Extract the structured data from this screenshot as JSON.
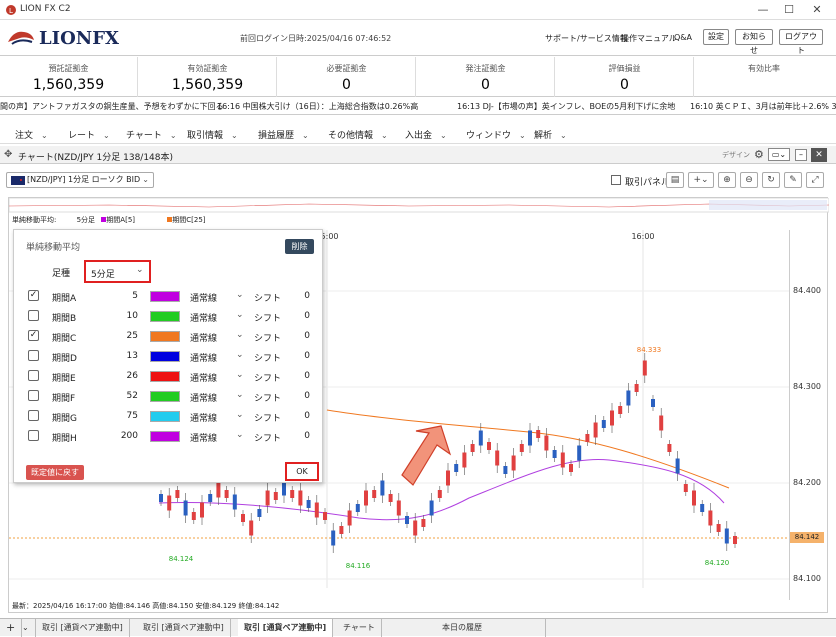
{
  "window": {
    "title": "LION FX C2",
    "minimize": "—",
    "maximize": "☐",
    "close": "✕"
  },
  "header": {
    "brand": "LIONFX",
    "last_login": "前回ログイン日時:2025/04/16 07:46:52",
    "links": [
      "サポート/サービス情報",
      "操作マニュアル",
      "Q&A"
    ],
    "buttons": [
      "設定",
      "お知らせ",
      "ログアウト"
    ]
  },
  "stats": [
    {
      "label": "預託証拠金",
      "value": "1,560,359"
    },
    {
      "label": "有効証拠金",
      "value": "1,560,359"
    },
    {
      "label": "必要証拠金",
      "value": "0"
    },
    {
      "label": "発注証拠金",
      "value": "0"
    },
    {
      "label": "評価損益",
      "value": "0"
    },
    {
      "label": "有効比率",
      "value": ""
    }
  ],
  "ticker": [
    "間の声】アントファガスタの銅生産量、予想をわずかに下回る",
    "16:16 中国株大引け（16日）：上海総合指数は0.26%高",
    "16:13 DJ-【市場の声】英インフレ、BOEの5月利下げに余地",
    "16:10 英ＣＰＩ、3月は前年比＋2.6%  3カ"
  ],
  "menu": [
    "注文",
    "レート",
    "チャート",
    "取引情報",
    "損益履歴",
    "その他情報",
    "入出金",
    "ウィンドウ",
    "解析"
  ],
  "panel": {
    "title": "チャート(NZD/JPY 1分足 138/148本)",
    "design": "デザイン"
  },
  "chart_toolbar": {
    "symbol": "[NZD/JPY] 1分足 ローソク BID",
    "trade_panel": "取引パネル"
  },
  "indicator_legend": {
    "label": "単純移動平均:",
    "timeframe": "5分足",
    "a": "期間A[5]",
    "c": "期間C[25]"
  },
  "dialog": {
    "title": "単純移動平均",
    "delete": "削除",
    "timeframe_label": "足種",
    "timeframe_value": "5分足",
    "reset": "既定値に戻す",
    "ok": "OK",
    "rows": [
      {
        "name": "期間A",
        "period": "5",
        "color": "#c000e0",
        "type": "通常線",
        "shift_label": "シフト",
        "shift": "0",
        "checked": true
      },
      {
        "name": "期間B",
        "period": "10",
        "color": "#22cc22",
        "type": "通常線",
        "shift_label": "シフト",
        "shift": "0",
        "checked": false
      },
      {
        "name": "期間C",
        "period": "25",
        "color": "#f07820",
        "type": "通常線",
        "shift_label": "シフト",
        "shift": "0",
        "checked": true
      },
      {
        "name": "期間D",
        "period": "13",
        "color": "#0000e0",
        "type": "通常線",
        "shift_label": "シフト",
        "shift": "0",
        "checked": false
      },
      {
        "name": "期間E",
        "period": "26",
        "color": "#ee1111",
        "type": "通常線",
        "shift_label": "シフト",
        "shift": "0",
        "checked": false
      },
      {
        "name": "期間F",
        "period": "52",
        "color": "#22cc22",
        "type": "通常線",
        "shift_label": "シフト",
        "shift": "0",
        "checked": false
      },
      {
        "name": "期間G",
        "period": "75",
        "color": "#22ccee",
        "type": "通常線",
        "shift_label": "シフト",
        "shift": "0",
        "checked": false
      },
      {
        "name": "期間H",
        "period": "200",
        "color": "#c000e0",
        "type": "通常線",
        "shift_label": "シフト",
        "shift": "0",
        "checked": false
      }
    ]
  },
  "chart": {
    "time_labels": [
      "15:00",
      "16:00"
    ],
    "y_ticks": [
      "84.400",
      "84.300",
      "84.200",
      "84.100"
    ],
    "current_price": "84.142",
    "high_label": "84.333",
    "low_labels": [
      "84.124",
      "84.116",
      "84.120"
    ],
    "footer": "最新：2025/04/16 16:17:00 始値:84.146 高値:84.150 安値:84.129 終値:84.142"
  },
  "bottom_tabs": [
    "取引 [通貨ペア連動中]",
    "取引 [通貨ペア連動中]",
    "取引 [通貨ペア連動中]",
    "チャート",
    "本日の履歴"
  ]
}
